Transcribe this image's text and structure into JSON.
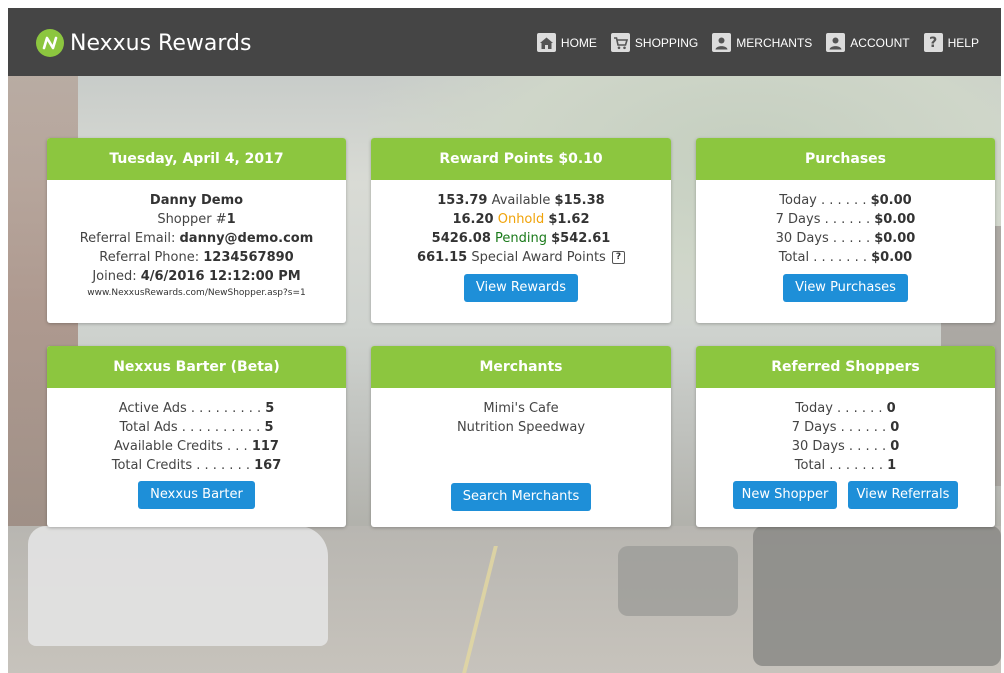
{
  "brand": {
    "name": "Nexxus Rewards",
    "logo": "N"
  },
  "nav": [
    {
      "icon": "home-icon",
      "label": "HOME"
    },
    {
      "icon": "shopping-cart-icon",
      "label": "SHOPPING"
    },
    {
      "icon": "merchants-icon",
      "label": "MERCHANTS"
    },
    {
      "icon": "account-icon",
      "label": "ACCOUNT"
    },
    {
      "icon": "help-icon",
      "label": "HELP",
      "glyph": "?"
    }
  ],
  "colors": {
    "header": "#454545",
    "card_header": "#8cc63f",
    "button": "#1e8fd8",
    "onhold": "#f0a30a",
    "pending": "#1a7a1a"
  },
  "profile": {
    "title": "Tuesday, April 4, 2017",
    "name": "Danny Demo",
    "shopper_prefix": "Shopper #",
    "shopper_number": "1",
    "referral_email_label": "Referral Email: ",
    "referral_email": "danny@demo.com",
    "referral_phone_label": "Referral Phone: ",
    "referral_phone": "1234567890",
    "joined_label": "Joined: ",
    "joined": "4/6/2016 12:12:00 PM",
    "referral_url": "www.NexxusRewards.com/NewShopper.asp?s=1"
  },
  "rewards": {
    "title": "Reward Points $0.10",
    "available_points": "153.79",
    "available_label": " Available ",
    "available_value": "$15.38",
    "onhold_points": "16.20",
    "onhold_label": " Onhold ",
    "onhold_value": "$1.62",
    "pending_points": "5426.08",
    "pending_label": " Pending ",
    "pending_value": "$542.61",
    "special_points": "661.15",
    "special_label": " Special Award Points ",
    "help_glyph": "?",
    "button": "View Rewards"
  },
  "purchases": {
    "title": "Purchases",
    "rows": [
      {
        "label": "Today . . . . . . ",
        "value": "$0.00"
      },
      {
        "label": "7 Days . . . . . . ",
        "value": "$0.00"
      },
      {
        "label": "30 Days . . . . . ",
        "value": "$0.00"
      },
      {
        "label": "Total . . . . . . . ",
        "value": "$0.00"
      }
    ],
    "button": "View Purchases"
  },
  "barter": {
    "title": "Nexxus Barter (Beta)",
    "rows": [
      {
        "label": "Active Ads . . . . . . . . . ",
        "value": "5"
      },
      {
        "label": "Total Ads . . . . . . . . . . ",
        "value": "5"
      },
      {
        "label": "Available Credits . . . ",
        "value": "117"
      },
      {
        "label": "Total Credits . . . . . . . ",
        "value": "167"
      }
    ],
    "button": "Nexxus Barter"
  },
  "merchants": {
    "title": "Merchants",
    "items": [
      "Mimi's Cafe",
      "Nutrition Speedway"
    ],
    "button": "Search Merchants"
  },
  "referred": {
    "title": "Referred Shoppers",
    "rows": [
      {
        "label": "Today . . . . . . ",
        "value": "0"
      },
      {
        "label": "7 Days . . . . . . ",
        "value": "0"
      },
      {
        "label": "30 Days . . . . . ",
        "value": "0"
      },
      {
        "label": "Total . . . . . . . ",
        "value": "1"
      }
    ],
    "button_new": "New Shopper",
    "button_view": "View Referrals"
  }
}
